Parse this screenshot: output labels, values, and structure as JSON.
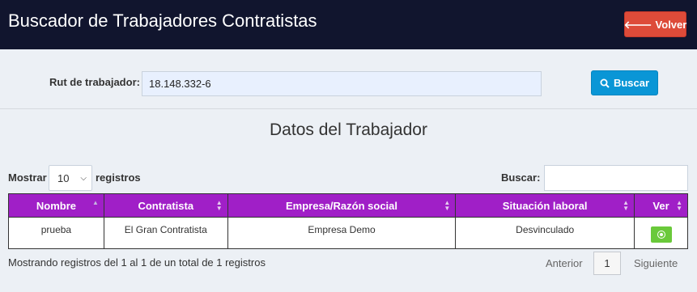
{
  "header": {
    "title": "Buscador de Trabajadores Contratistas",
    "back_label": "Volver"
  },
  "search": {
    "label": "Rut de trabajador:",
    "value": "18.148.332-6",
    "button_label": "Buscar"
  },
  "section_title": "Datos del Trabajador",
  "table_controls": {
    "show_label": "Mostrar",
    "page_length": "10",
    "records_label": "registros",
    "filter_label": "Buscar:"
  },
  "table": {
    "columns": [
      "Nombre",
      "Contratista",
      "Empresa/Razón social",
      "Situación laboral",
      "Ver"
    ],
    "rows": [
      [
        "prueba",
        "El Gran Contratista",
        "Empresa Demo",
        "Desvinculado"
      ]
    ]
  },
  "footer": {
    "info": "Mostrando registros del 1 al 1 de un total de 1 registros",
    "prev_label": "Anterior",
    "current_page": "1",
    "next_label": "Siguiente"
  },
  "colors": {
    "header_bg": "#11152e",
    "table_header_bg": "#a01fc7",
    "back_button": "#dd4b39",
    "search_button": "#0a96d6",
    "view_button": "#6ac93a"
  },
  "icons": {
    "back": "arrow-left-icon",
    "search": "search-icon",
    "view": "eye-icon"
  }
}
